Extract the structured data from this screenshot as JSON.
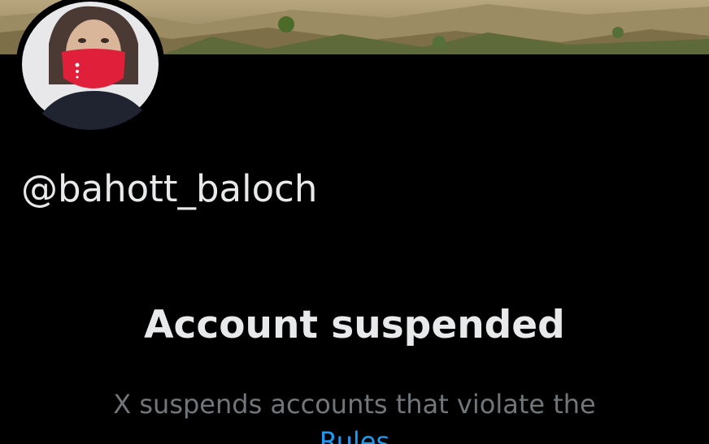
{
  "profile": {
    "handle": "@bahott_baloch",
    "banner_image": "mountain-landscape-banner",
    "avatar_image": "profile-photo-person-red-mask"
  },
  "suspension": {
    "title": "Account suspended",
    "description": "X suspends accounts that violate the",
    "rules_link": "Rules"
  },
  "colors": {
    "background": "#000000",
    "primary_text": "#e7e9ea",
    "secondary_text": "#71767b",
    "link": "#1d9bf0"
  }
}
